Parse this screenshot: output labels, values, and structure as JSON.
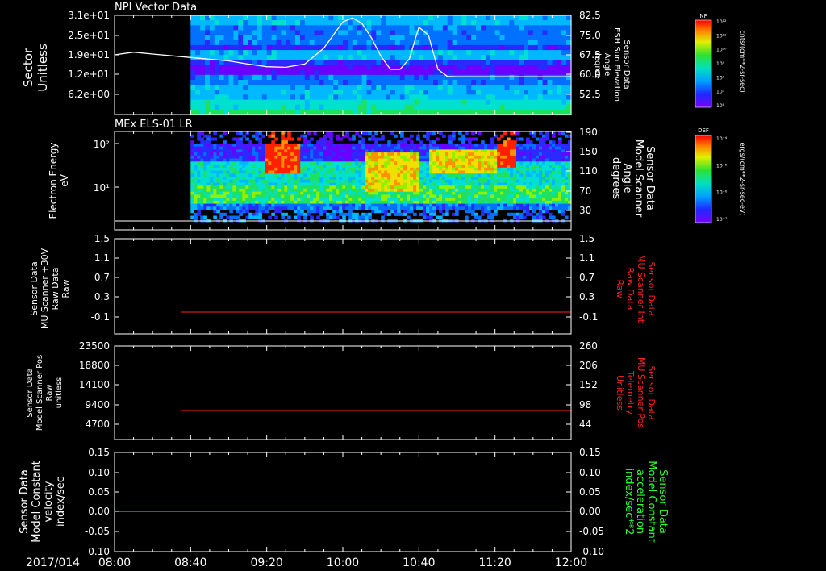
{
  "time_axis": {
    "date": "2017/014",
    "ticks": [
      "08:00",
      "08:40",
      "09:20",
      "10:00",
      "10:40",
      "11:20",
      "12:00"
    ]
  },
  "colorbars": [
    {
      "tag": "NF",
      "unit": "cnts/(cm**2-sr-sec)",
      "tick_labels": [
        "10¹²",
        "10¹¹",
        "10¹⁰",
        "10⁹",
        "10⁸",
        "10⁷",
        "10⁶"
      ]
    },
    {
      "tag": "DEF",
      "unit": "ergs/(cm**2-sr-sec-eV)",
      "tick_labels": [
        "10⁻⁴",
        "10⁻⁵",
        "10⁻⁶",
        "10⁻⁷"
      ]
    }
  ],
  "chart_data": [
    {
      "type": "heatmap",
      "title": "NPI Vector Data",
      "ylabel": [
        "Sector",
        "Unitless"
      ],
      "y_ticks": [
        "3.1e+01",
        "2.5e+01",
        "1.9e+01",
        "1.2e+01",
        "6.2e+00"
      ],
      "y2label": [
        "Sensor Data",
        "ESH Sun Elevation",
        "Angle",
        "degree"
      ],
      "y2_ticks": [
        "82.5",
        "75.0",
        "67.5",
        "60.0",
        "52.5"
      ],
      "data_start": "08:40",
      "overlay_line": {
        "name": "ESH Sun Elevation",
        "x": [
          "08:00",
          "08:10",
          "08:20",
          "08:40",
          "09:00",
          "09:10",
          "09:20",
          "09:30",
          "09:40",
          "09:50",
          "10:00",
          "10:05",
          "10:10",
          "10:15",
          "10:20",
          "10:25",
          "10:30",
          "10:35",
          "10:40",
          "10:45",
          "10:50",
          "10:55",
          "11:00",
          "11:20",
          "11:40",
          "12:00"
        ],
        "y": [
          67.5,
          68.5,
          67.8,
          66.5,
          65.2,
          64.0,
          63.0,
          62.8,
          64.0,
          70.0,
          80.0,
          81.5,
          79.5,
          74.0,
          67.0,
          62.0,
          62.0,
          66.0,
          78.0,
          75.0,
          62.0,
          59.3,
          59.2,
          59.2,
          59.2,
          59.2
        ]
      }
    },
    {
      "type": "heatmap",
      "title": "MEx ELS-01 LR",
      "ylabel": [
        "Electron Energy",
        "eV"
      ],
      "y_ticks": [
        "10²",
        "10¹"
      ],
      "y2label": [
        "Sensor Data",
        "Model Scanner",
        "Angle",
        "degrees"
      ],
      "y2_ticks": [
        "190",
        "150",
        "110",
        "70",
        "30"
      ],
      "data_start": "08:40"
    },
    {
      "type": "line",
      "ylabel": [
        "Sensor Data",
        "MU Scanner +30V",
        "Raw Data",
        "Raw"
      ],
      "y_ticks": [
        "1.5",
        "1.1",
        "0.7",
        "0.3",
        "-0.1"
      ],
      "y2label": [
        "Sensor Data",
        "MU Scanner Int",
        "Raw Data",
        "Raw"
      ],
      "y2_ticks": [
        "1.5",
        "1.1",
        "0.7",
        "0.3",
        "-0.1"
      ],
      "series": [
        {
          "x": [
            "08:35",
            "12:00"
          ],
          "y": [
            0.0,
            0.0
          ],
          "color": "#ff2020"
        }
      ]
    },
    {
      "type": "line",
      "ylabel": [
        "Sensor Data",
        "Model Scanner Pos",
        "Raw",
        "unitless"
      ],
      "y_ticks": [
        "23500",
        "18800",
        "14100",
        "9400",
        "4700"
      ],
      "y2label": [
        "Sensor Data",
        "MU Scanner Pos",
        "Telemetry",
        "Unitless"
      ],
      "y2_ticks": [
        "260",
        "206",
        "152",
        "98",
        "44"
      ],
      "series": [
        {
          "x": [
            "08:35",
            "12:00"
          ],
          "y": [
            8000,
            8000
          ],
          "color": "#ff2020"
        }
      ]
    },
    {
      "type": "line",
      "ylabel": [
        "Sensor Data",
        "Model Constant",
        "velocity",
        "index/sec"
      ],
      "y_ticks": [
        "0.15",
        "0.10",
        "0.05",
        "0.00",
        "-0.05",
        "-0.10"
      ],
      "y2label": [
        "Sensor Data",
        "Model Constant",
        "acceleration",
        "index/sec**2"
      ],
      "y2_ticks": [
        "0.15",
        "0.10",
        "0.05",
        "0.00",
        "-0.05",
        "-0.10"
      ],
      "series": [
        {
          "x": [
            "08:00",
            "12:00"
          ],
          "y": [
            0.0,
            0.0
          ],
          "color": "#30ff30"
        }
      ]
    }
  ],
  "colors": {
    "red_label": "#ff2020",
    "green_label": "#30ff30",
    "axis": "#ffffff"
  }
}
